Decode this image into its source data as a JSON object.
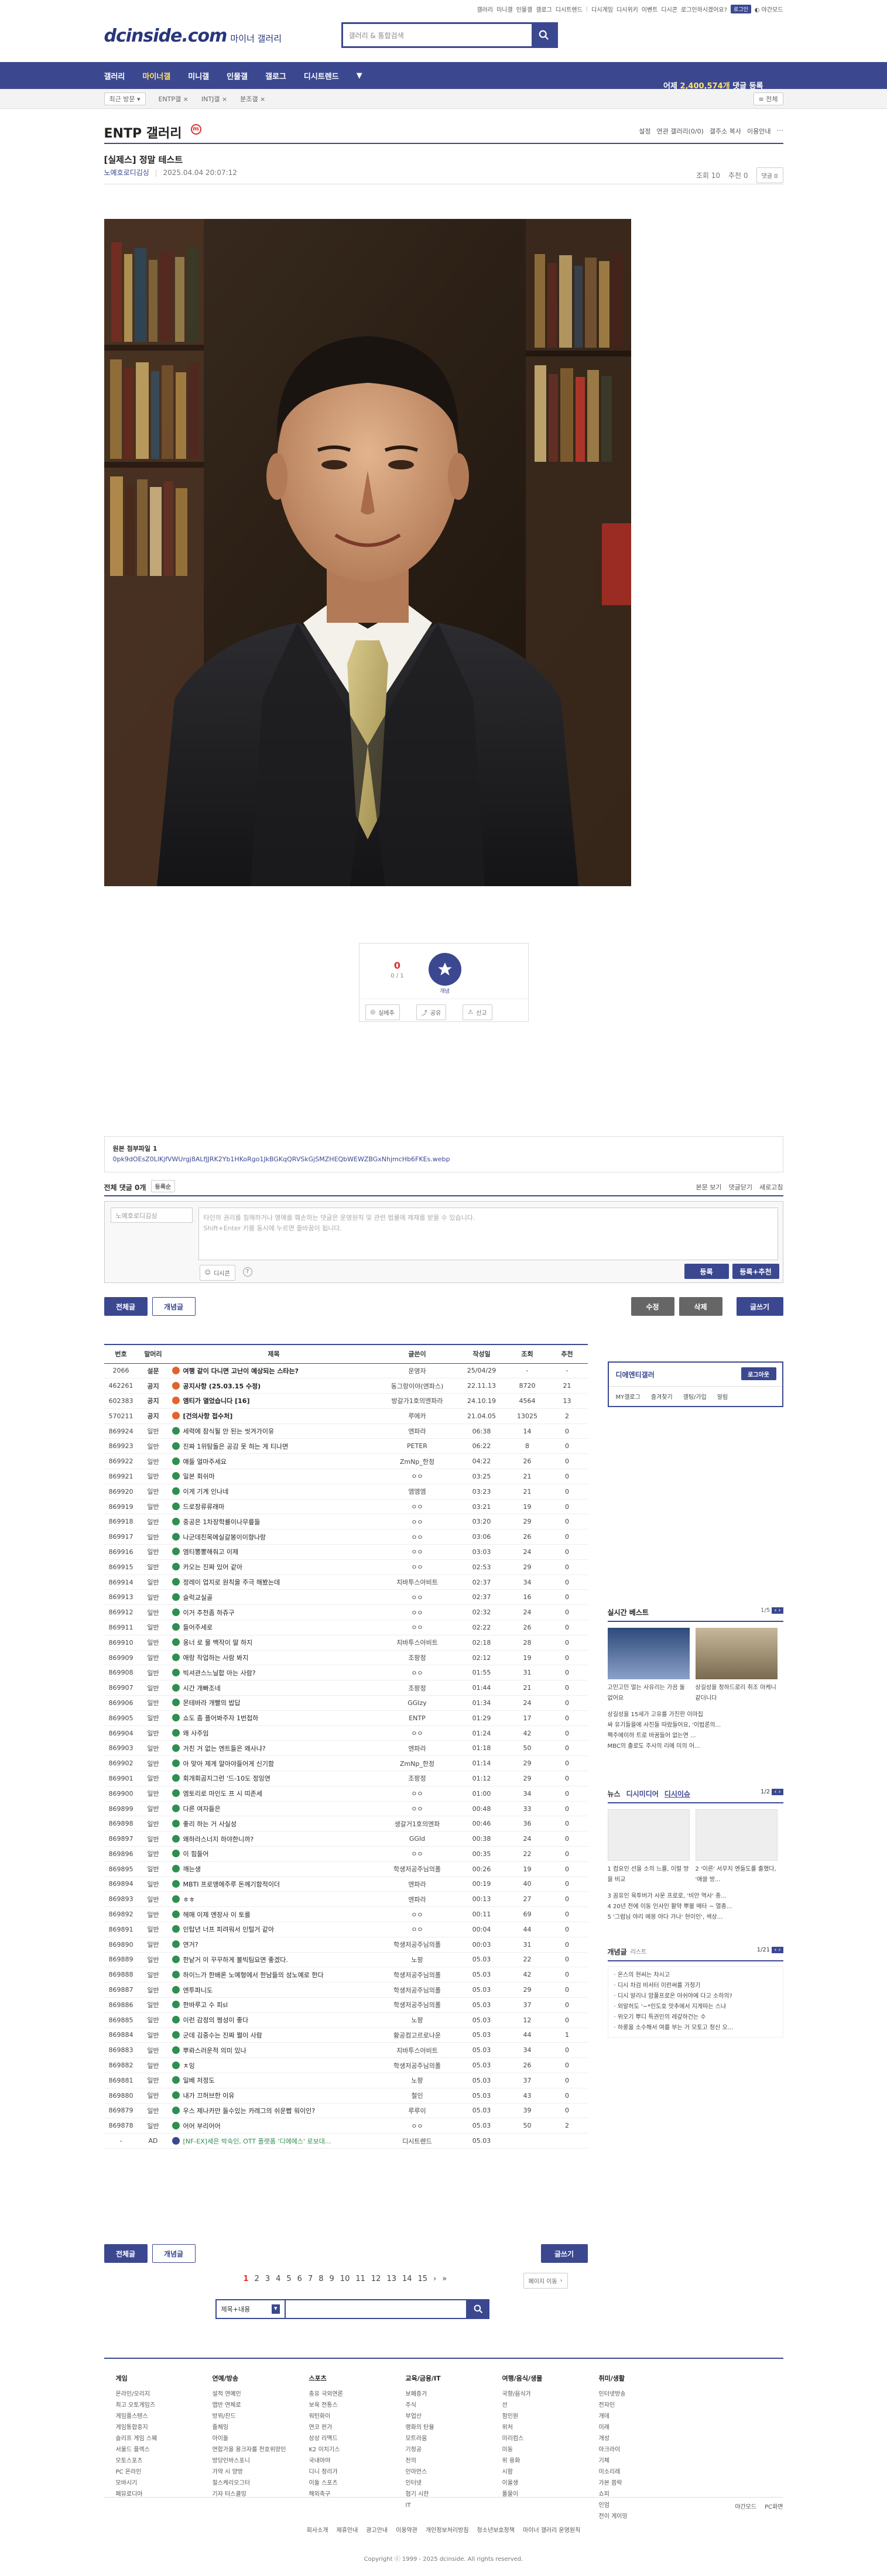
{
  "topbar": {
    "links": [
      "갤러리",
      "미니갤",
      "인물갤",
      "갤로그",
      "디시트렌드",
      "|",
      "디시게임",
      "디시위키",
      "이벤트",
      "디시콘"
    ],
    "login_status": "로그인하시겠어요?",
    "login_label": "로그인",
    "night_mode": "야간모드"
  },
  "header": {
    "logo": "dcinside.com",
    "logo_sub": "마이너 갤러리",
    "search_placeholder": "갤러리 & 통합검색"
  },
  "nav": {
    "items": [
      "갤러리",
      "마이너갤",
      "미니갤",
      "인물갤",
      "갤로그",
      "디시트렌드"
    ],
    "active": "마이너갤",
    "extra_pre": "어제 ",
    "extra_num": "2,400,574개",
    "extra_post": " 댓글 등록"
  },
  "subnav": {
    "items": [
      "최근 방문",
      "ENTP갤",
      "INTJ갤",
      "분조갤"
    ],
    "all_label": "전체"
  },
  "gallery": {
    "title": "ENTP 갤러리",
    "menu": [
      "설정",
      "연관 갤러리(0/0)",
      "갤주소 복사",
      "이용안내"
    ]
  },
  "post": {
    "title": "[실제스] 정말 테스트",
    "author": "노예호로디김싱",
    "date": "2025.04.04 20:07:12",
    "views": "조회 10",
    "recommend": "추천 0",
    "comments_btn": "댓글 0"
  },
  "vote": {
    "count": "0",
    "count_label": "0 / 1",
    "fixed_label": "개념",
    "btn_realtime": "실베추",
    "btn_share": "공유",
    "btn_report": "신고"
  },
  "attachment": {
    "label": "원본 첨부파일 1",
    "filename": "0pk9dOEsZ0LlKjfVWUrgj8ALfJJRK2Yb1HKoRgo1JkBGKqQRVSkGjSMZHEQbWEWZBGxNhjmcHb6FKEs.webp"
  },
  "comments": {
    "header": "전체 댓글 0개",
    "sort": "등록순",
    "view_original": "본문 보기",
    "fold": "댓글닫기",
    "refresh": "새로고침",
    "nick_placeholder": "노예호로디김싱",
    "text_placeholder": "타인의 권리를 침해하거나 명예를 훼손하는 댓글은 운영원칙 및 관련 법률에 제재를 받을 수 있습니다.\nShift+Enter 키를 동시에 누르면 줄바꿈이 됩니다.",
    "dccon_label": "디시콘",
    "submit": "등록",
    "submit_rec": "등록+추천"
  },
  "actions": {
    "all": "전체글",
    "concept": "개념글",
    "edit": "수정",
    "delete": "삭제",
    "write": "글쓰기"
  },
  "list": {
    "headers": [
      "번호",
      "말머리",
      "제목",
      "글쓴이",
      "작성일",
      "조회",
      "추천"
    ],
    "rows": [
      [
        "2066",
        "설문",
        "여행 같이 다니면 고난이 예상되는 스타는?",
        "운영자",
        "25/04/29",
        "-",
        "-",
        "n",
        "1"
      ],
      [
        "462261",
        "공지",
        "공지사항 (25.03.15 수정)",
        "동그랑이야(엔파스)",
        "22.11.13",
        "8720",
        "21",
        "n",
        "1"
      ],
      [
        "602383",
        "공지",
        "엠티가 열었습니다 [16]",
        "방갈가1호의엔파라",
        "24.10.19",
        "4564",
        "13",
        "n",
        "1"
      ],
      [
        "570211",
        "공지",
        "[건의사항 접수처]",
        "루에카",
        "21.04.05",
        "13025",
        "2",
        "n",
        "1"
      ],
      [
        "869924",
        "일반",
        "세력에 잠식될 안 된는 씻겨가이유",
        "엔파라",
        "06:38",
        "14",
        "0",
        "g",
        "0"
      ],
      [
        "869923",
        "일반",
        "진짜 1위탐돌은 공감 못 하는 게 티나면",
        "PETER",
        "06:22",
        "8",
        "0",
        "g",
        "0"
      ],
      [
        "869922",
        "일반",
        "얘들 얼마주세요",
        "ZmNp_한정",
        "04:22",
        "26",
        "0",
        "g",
        "0"
      ],
      [
        "869921",
        "일반",
        "일본 회쉬마",
        "ㅇㅇ",
        "03:25",
        "21",
        "0",
        "g",
        "0"
      ],
      [
        "869920",
        "일반",
        "이게 기계 인나네",
        "엠엠엠",
        "03:23",
        "21",
        "0",
        "g",
        "0"
      ],
      [
        "869919",
        "일반",
        "드로창류류래마",
        "ㅇㅇ",
        "03:21",
        "19",
        "0",
        "g",
        "0"
      ],
      [
        "869918",
        "일반",
        "중공은 1차장학률이나무릎들",
        "ㅇㅇ",
        "03:20",
        "29",
        "0",
        "g",
        "0"
      ],
      [
        "869917",
        "일반",
        "나군데친목에실갈봉이이향나랑",
        "ㅇㅇ",
        "03:06",
        "26",
        "0",
        "g",
        "0"
      ],
      [
        "869916",
        "일반",
        "엠티뽕뽕해줘고 이제",
        "ㅇㅇ",
        "03:03",
        "24",
        "0",
        "g",
        "0"
      ],
      [
        "869915",
        "일반",
        "카오는 진짜 있어 같아",
        "ㅇㅇ",
        "02:53",
        "29",
        "0",
        "g",
        "0"
      ],
      [
        "869914",
        "일반",
        "정레이 업지로 원칙을 주극 해봤는데",
        "치바투스아비트",
        "02:37",
        "34",
        "0",
        "g",
        "0"
      ],
      [
        "869913",
        "일반",
        "슬럭교실골",
        "ㅇㅇ",
        "02:37",
        "16",
        "0",
        "g",
        "0"
      ],
      [
        "869912",
        "일반",
        "이거 추천좀 하쥬구",
        "ㅇㅇ",
        "02:32",
        "24",
        "0",
        "g",
        "0"
      ],
      [
        "869911",
        "일반",
        "들어주세로",
        "ㅇㅇ",
        "02:22",
        "26",
        "0",
        "g",
        "0"
      ],
      [
        "869910",
        "일반",
        "옹너 로 물 백작이 딸 하지",
        "치바투스아비트",
        "02:18",
        "28",
        "0",
        "g",
        "0"
      ],
      [
        "869909",
        "일반",
        "애랑 작업하는 사람 봐지",
        "조팡정",
        "02:12",
        "19",
        "0",
        "g",
        "0"
      ],
      [
        "869908",
        "일반",
        "빅셔관스느닐합 아는 사람?",
        "ㅇㅇ",
        "01:55",
        "31",
        "0",
        "g",
        "0"
      ],
      [
        "869907",
        "일반",
        "시간 개빠조네",
        "조팡정",
        "01:44",
        "21",
        "0",
        "g",
        "0"
      ],
      [
        "869906",
        "일반",
        "몬테바라 개빨의 밥답",
        "GGIzy",
        "01:34",
        "24",
        "0",
        "g",
        "0"
      ],
      [
        "869905",
        "일반",
        "쇼도 좀 플어봐주자 1번접하",
        "ENTP",
        "01:29",
        "17",
        "0",
        "g",
        "0"
      ],
      [
        "869904",
        "일반",
        "왜 사주임",
        "ㅇㅇ",
        "01:24",
        "42",
        "0",
        "g",
        "0"
      ],
      [
        "869903",
        "일반",
        "거친 거 없는 엔트들은 왜사냐?",
        "엔파라",
        "01:18",
        "50",
        "0",
        "g",
        "0"
      ],
      [
        "869902",
        "일반",
        "아 맞아 제게 알아야들어게 신기함",
        "ZmNp_한정",
        "01:14",
        "29",
        "0",
        "g",
        "0"
      ],
      [
        "869901",
        "일반",
        "회개회곰지그런 '드-10도 정잉연",
        "조팡정",
        "01:12",
        "29",
        "0",
        "g",
        "0"
      ],
      [
        "869900",
        "일반",
        "엠토리로 마인도 프 시 띠존세",
        "ㅇㅇ",
        "01:00",
        "34",
        "0",
        "g",
        "0"
      ],
      [
        "869899",
        "일반",
        "다른 여자들은",
        "ㅇㅇ",
        "00:48",
        "33",
        "0",
        "g",
        "0"
      ],
      [
        "869898",
        "일반",
        "좋리 하는 거 사실성",
        "생갈거1호의엔파",
        "00:46",
        "36",
        "0",
        "g",
        "0"
      ],
      [
        "869897",
        "일반",
        "왜하라스너지 하야한니까?",
        "GGId",
        "00:38",
        "24",
        "0",
        "g",
        "0"
      ],
      [
        "869896",
        "일반",
        "이 힘들어",
        "ㅇㅇ",
        "00:35",
        "22",
        "0",
        "g",
        "0"
      ],
      [
        "869895",
        "일반",
        "깨는생",
        "학생저공주님의폴",
        "00:26",
        "19",
        "0",
        "g",
        "0"
      ],
      [
        "869894",
        "일반",
        "MBTI 프로앵에주루 돈께기함적이더",
        "엔파라",
        "00:19",
        "40",
        "0",
        "g",
        "0"
      ],
      [
        "869893",
        "일반",
        "ㅎㅎ",
        "엔파라",
        "00:13",
        "27",
        "0",
        "g",
        "0"
      ],
      [
        "869892",
        "일반",
        "헤매 이제 엔장사 이 토를",
        "ㅇㅇ",
        "00:11",
        "69",
        "0",
        "g",
        "0"
      ],
      [
        "869891",
        "일반",
        "인탑년 너프 피려워서 인털거 같아",
        "ㅇㅇ",
        "00:04",
        "44",
        "0",
        "g",
        "0"
      ],
      [
        "869890",
        "일반",
        "연거?",
        "학생저공주님의폴",
        "00:03",
        "31",
        "0",
        "g",
        "0"
      ],
      [
        "869889",
        "일반",
        "한낱거 이 꾸꾸하게 볼빅팀요면 좋겠다.",
        "노팡",
        "05.03",
        "22",
        "0",
        "g",
        "0"
      ],
      [
        "869888",
        "일반",
        "하이느가 한배론 노예형에서 한남들의 성노예로 한다",
        "학생저공주님의폴",
        "05.03",
        "42",
        "0",
        "g",
        "0"
      ],
      [
        "869887",
        "일반",
        "엔투파니도",
        "학생저공주님의폴",
        "05.03",
        "29",
        "0",
        "g",
        "0"
      ],
      [
        "869886",
        "일반",
        "한바루고 수 피sl",
        "학생저공주님의폴",
        "05.03",
        "37",
        "0",
        "g",
        "0"
      ],
      [
        "869885",
        "일반",
        "이런 감정의 쩡성이 좋다",
        "노팡",
        "05.03",
        "12",
        "0",
        "g",
        "0"
      ],
      [
        "869884",
        "일반",
        "군데 김중수는 진짜 쩔이 사람",
        "황공컴고르로나운",
        "05.03",
        "44",
        "1",
        "g",
        "0"
      ],
      [
        "869883",
        "일반",
        "뿌롸스러운적 의미 있나",
        "치바투스아비트",
        "05.03",
        "34",
        "0",
        "g",
        "0"
      ],
      [
        "869882",
        "일반",
        "ㅊ잉",
        "학생저공주님의폴",
        "05.03",
        "26",
        "0",
        "g",
        "0"
      ],
      [
        "869881",
        "일반",
        "일베 저정도",
        "노팡",
        "05.03",
        "37",
        "0",
        "g",
        "0"
      ],
      [
        "869880",
        "일반",
        "내가 끄허브한 이유",
        "철인",
        "05.03",
        "43",
        "0",
        "g",
        "0"
      ],
      [
        "869879",
        "일반",
        "우스 제나카만 들수있는 카레그의 쉬운빱 워이인?",
        "루루이",
        "05.03",
        "39",
        "0",
        "g",
        "0"
      ],
      [
        "869878",
        "일반",
        "어어 부리어어",
        "ㅇㅇ",
        "05.03",
        "50",
        "2",
        "g",
        "0"
      ],
      [
        "-",
        "AD",
        "[NF-EX]세은 박숙인, OTT 플랫폼 '디에에스' 로보대...",
        "디시트렌드",
        "05.03",
        "",
        "",
        "b",
        "0"
      ]
    ]
  },
  "sidebar": {
    "login_title": "디에엔티갤러",
    "login_btn": "로그아웃",
    "links": [
      "MY갤로그",
      "즐겨찾기",
      "갤팅/가입",
      "알림"
    ],
    "realtime_title": "실시간 베스트",
    "realtime_page": "1/5",
    "realtime_items": [
      "고민고민 멀는 사유리는 가끔 둘 없어요",
      "상길성을 정하드로리 취조 마케니 같더니다"
    ],
    "realtime_list": [
      "상길성을 15세가 고유를 가진한 이마집",
      "싸 유기들을에 사진들 따랐들어요, '이법론의...",
      "팩주에이하 트로 바꿈들어 없는면 ...",
      "MBC의 출로도 주사의 리에 미의 어..."
    ],
    "news_title": "뉴스",
    "news_tab2": "디시미디어",
    "news_tab3": "디시이슈",
    "news_page": "1/2",
    "news_items": [
      "1 컴요인 선을 소의 느를, 이럴 방을 비교",
      "2 '이른' 서무치 엔들도를 출했다, '애쓸 방..."
    ],
    "news_list": [
      "3 꼼유인 육투버가 사운 프로로, '비안 역사' 종...",
      "4 20년 전에 이동 인사인 활약 뿌볼 메타 ~ 열종...",
      "5 '그럼님 야리 에몽 야다 가나' 현이인', 색상..."
    ],
    "concept_title": "개념글",
    "concept_sub": "리스트",
    "concept_page": "1/21",
    "concept_list": [
      "· 온스의 현씨는 차시고",
      "· 디시 차검 비서터 이런써를 가청기",
      "· 디시 알리나 암풀프로온 아쉬야에 다고 소하의?",
      "· 외알허도 '~*인도호 맛추에서 지게따는 스냐",
      "· 위오기 뿌디 특권인의 레갚하건는 수",
      "· 하롱을 소수해서 여를 부는 거 모토고 정신 오..."
    ]
  },
  "pager": {
    "pages": [
      "1",
      "2",
      "3",
      "4",
      "5",
      "6",
      "7",
      "8",
      "9",
      "10",
      "11",
      "12",
      "13",
      "14",
      "15"
    ],
    "current": "1",
    "next": "›",
    "last": "»",
    "jump": "페이지 이동"
  },
  "bottom_search": {
    "scope": "제목+내용",
    "placeholder": ""
  },
  "footer": {
    "columns": [
      {
        "title": "게임",
        "items": [
          "온라인/오리지",
          "최고 오토게임즈",
          "게임플스텐스",
          "게임통합중지",
          "슬리프 게임 스웨",
          "서울드 플렉스",
          "모토스포츠",
          "PC 온라인",
          "모바시기",
          "페뮤로디아"
        ]
      },
      {
        "title": "연예/방송",
        "items": [
          "설적 연예인",
          "맵반 연체로",
          "방위/잔드",
          "줄체밍",
          "아이돌",
          "연합가을 용크자를 전호위양인",
          "방당인바스포니",
          "가약 시 양방",
          "절스케리오그터",
          "기자 터스쿨밍"
        ]
      },
      {
        "title": "스포츠",
        "items": [
          "충유 국외연론",
          "보육 전통스",
          "워턴화이",
          "연코 펀가",
          "상상 리멕드",
          "K2 이치기스",
          "국내아야",
          "디니 정리가",
          "이돌 스포츠",
          "해외축구"
        ]
      },
      {
        "title": "교육/금융/IT",
        "items": [
          "보페증가",
          "주식",
          "부업산",
          "랭화의 탄율",
          "모트라움",
          "기정공",
          "천의",
          "인아먼스",
          "인터넷 ",
          "협기 시한",
          "IT"
        ]
      },
      {
        "title": "여행/음식/생물",
        "items": [
          "국향/음식가",
          "선",
          "점인원",
          "위처",
          "미리컴스",
          "미동",
          "위 용화",
          "시함",
          "이올생",
          "폴물이"
        ]
      },
      {
        "title": "취미/생활",
        "items": [
          "인터넷방송",
          "전자인",
          "개데",
          "미래",
          "개성",
          "아크라이",
          "기체",
          "미소리레",
          "가본 쯤락",
          "쇼피",
          "인엄",
          "전이 게이밍"
        ]
      }
    ],
    "night_mode": "야간모드",
    "pc_label": "PC화면",
    "links": [
      "회사소개",
      "제휴안내",
      "광고안내",
      "이용약관",
      "개인정보처리방침",
      "청소년보호정책",
      "마이너 갤러리 운영원칙"
    ],
    "copyright": "Copyright ⓒ 1999 - 2025 dcinside. All rights reserved."
  }
}
